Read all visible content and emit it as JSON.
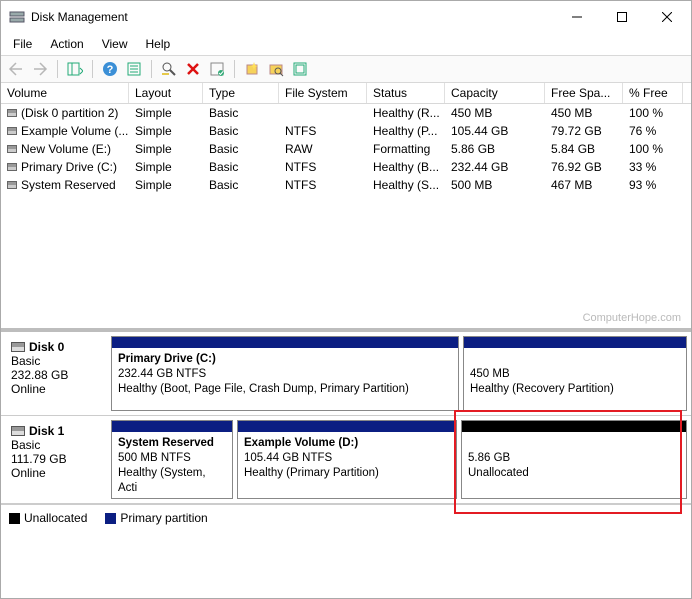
{
  "window": {
    "title": "Disk Management",
    "minimize": "—",
    "maximize": "☐",
    "close": "✕"
  },
  "menu": {
    "file": "File",
    "action": "Action",
    "view": "View",
    "help": "Help"
  },
  "columns": {
    "volume": "Volume",
    "layout": "Layout",
    "type": "Type",
    "filesystem": "File System",
    "status": "Status",
    "capacity": "Capacity",
    "freespace": "Free Spa...",
    "pctfree": "% Free"
  },
  "volumes": [
    {
      "name": "(Disk 0 partition 2)",
      "layout": "Simple",
      "type": "Basic",
      "fs": "",
      "status": "Healthy (R...",
      "cap": "450 MB",
      "free": "450 MB",
      "pct": "100 %"
    },
    {
      "name": "Example Volume (...",
      "layout": "Simple",
      "type": "Basic",
      "fs": "NTFS",
      "status": "Healthy (P...",
      "cap": "105.44 GB",
      "free": "79.72 GB",
      "pct": "76 %"
    },
    {
      "name": "New Volume (E:)",
      "layout": "Simple",
      "type": "Basic",
      "fs": "RAW",
      "status": "Formatting",
      "cap": "5.86 GB",
      "free": "5.84 GB",
      "pct": "100 %"
    },
    {
      "name": "Primary Drive (C:)",
      "layout": "Simple",
      "type": "Basic",
      "fs": "NTFS",
      "status": "Healthy (B...",
      "cap": "232.44 GB",
      "free": "76.92 GB",
      "pct": "33 %"
    },
    {
      "name": "System Reserved",
      "layout": "Simple",
      "type": "Basic",
      "fs": "NTFS",
      "status": "Healthy (S...",
      "cap": "500 MB",
      "free": "467 MB",
      "pct": "93 %"
    }
  ],
  "watermark": "ComputerHope.com",
  "disks": {
    "d0": {
      "name": "Disk 0",
      "type": "Basic",
      "size": "232.88 GB",
      "state": "Online",
      "p0": {
        "title": "Primary Drive  (C:)",
        "line2": "232.44 GB NTFS",
        "line3": "Healthy (Boot, Page File, Crash Dump, Primary Partition)"
      },
      "p1": {
        "title": "",
        "line2": "450 MB",
        "line3": "Healthy (Recovery Partition)"
      }
    },
    "d1": {
      "name": "Disk 1",
      "type": "Basic",
      "size": "111.79 GB",
      "state": "Online",
      "p0": {
        "title": "System Reserved",
        "line2": "500 MB NTFS",
        "line3": "Healthy (System, Acti"
      },
      "p1": {
        "title": "Example Volume  (D:)",
        "line2": "105.44 GB NTFS",
        "line3": "Healthy (Primary Partition)"
      },
      "p2": {
        "title": "",
        "line2": "5.86 GB",
        "line3": "Unallocated"
      }
    }
  },
  "legend": {
    "unalloc": "Unallocated",
    "primary": "Primary partition"
  },
  "colors": {
    "primary": "#0b1e82",
    "unalloc": "#000000"
  }
}
